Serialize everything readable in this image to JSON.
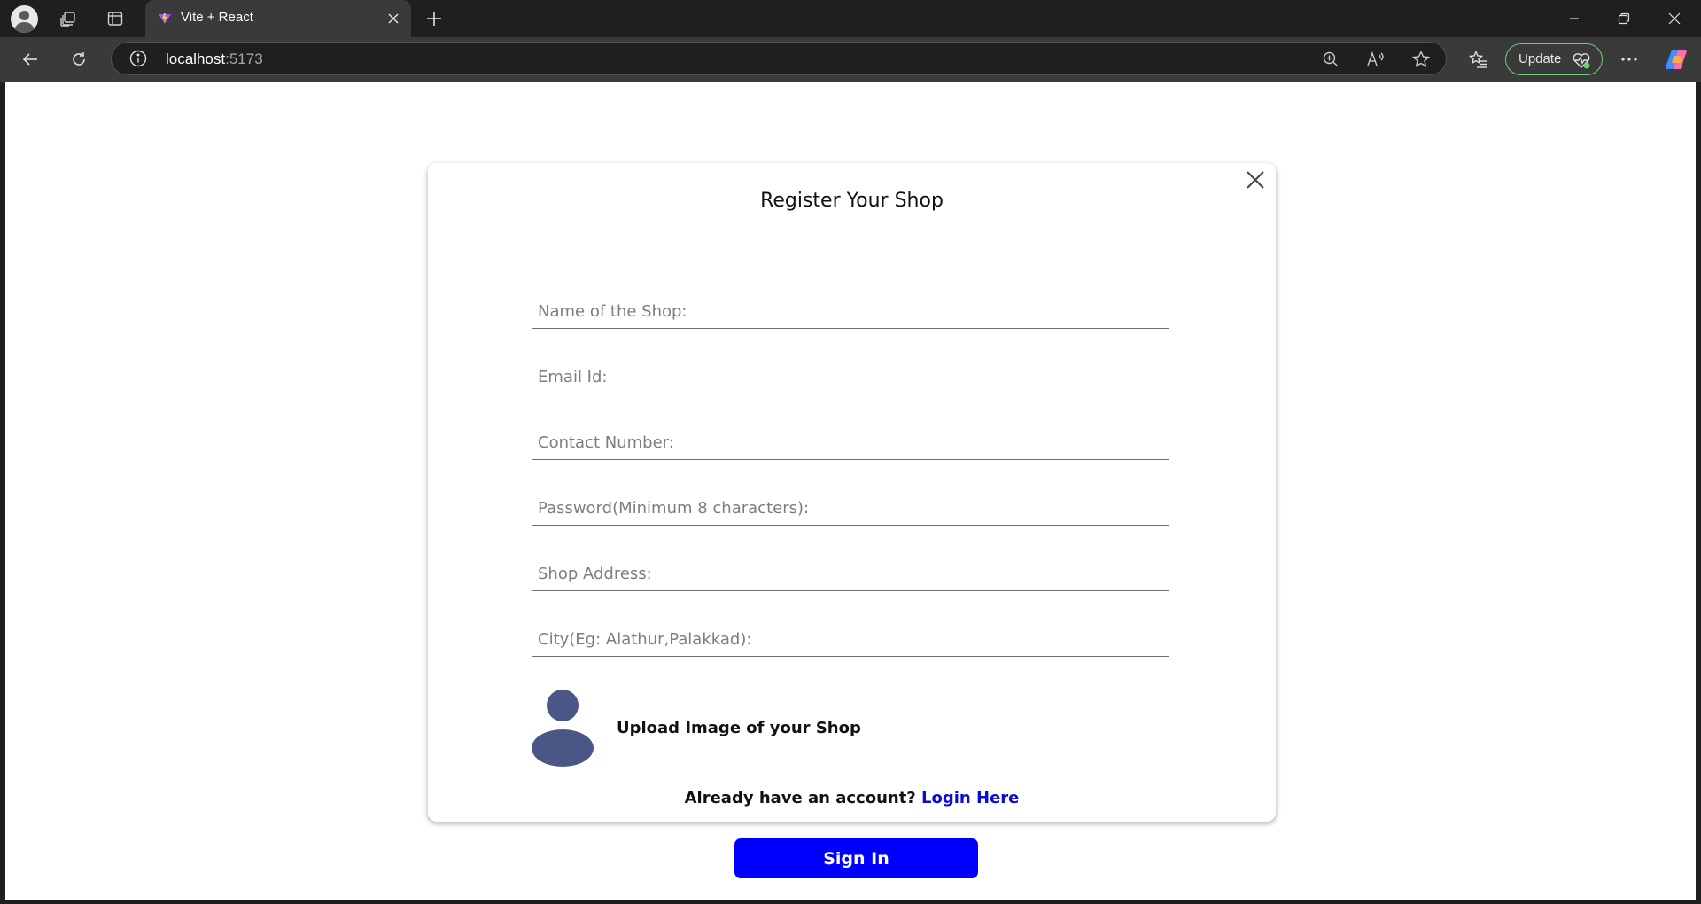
{
  "browser": {
    "tab": {
      "title": "Vite + React",
      "favicon": "vite-logo-icon"
    },
    "address": {
      "host": "localhost",
      "port": ":5173"
    },
    "update_button": {
      "label": "Update"
    },
    "colors": {
      "chrome_dark": "#1f1f1f",
      "toolbar": "#3a3a3a",
      "update_border": "#6fcf7a"
    }
  },
  "form": {
    "title": "Register Your Shop",
    "fields": {
      "shop_name": {
        "placeholder": "Name of the Shop:"
      },
      "email": {
        "placeholder": "Email Id:"
      },
      "contact": {
        "placeholder": "Contact Number:"
      },
      "password": {
        "placeholder": "Password(Minimum 8 characters):"
      },
      "address": {
        "placeholder": "Shop Address:"
      },
      "city": {
        "placeholder": "City(Eg: Alathur,Palakkad):"
      }
    },
    "upload": {
      "label": "Upload Image of your Shop",
      "icon": "user-avatar-icon"
    },
    "account_prompt": "Already have an account?",
    "login_link": "Login Here",
    "submit_label": "Sign In",
    "colors": {
      "primary": "#0000ff",
      "link": "#0b0bd6",
      "avatar": "#4a5685"
    }
  }
}
